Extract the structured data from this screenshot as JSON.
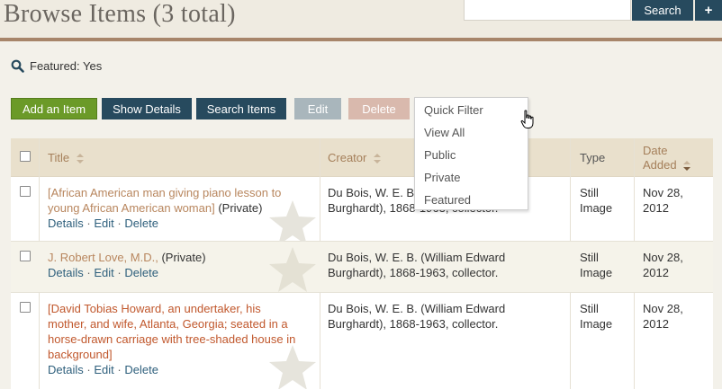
{
  "header": {
    "title": "Browse Items (3 total)",
    "search_placeholder": "",
    "search_button": "Search",
    "advanced_button": "+"
  },
  "filter": {
    "label": "Featured: Yes"
  },
  "toolbar": {
    "add": "Add an Item",
    "show_details": "Show Details",
    "search_items": "Search Items",
    "edit": "Edit",
    "delete": "Delete"
  },
  "dropdown": {
    "options": [
      "Quick Filter",
      "View All",
      "Public",
      "Private",
      "Featured"
    ]
  },
  "table": {
    "headers": {
      "title": "Title",
      "creator": "Creator",
      "type": "Type",
      "date_added_1": "Date",
      "date_added_2": "Added"
    },
    "rows": [
      {
        "title_1": "[African American man giving piano lesson to",
        "title_2": "young African American woman]",
        "status": "(Private)",
        "creator_1": "Du Bois, W. E. B. (",
        "creator_2": "Burghardt), 1868-1963, collector.",
        "type_1": "Still",
        "type_2": "Image",
        "date_1": "Nov 28,",
        "date_2": "2012"
      },
      {
        "title_1": "J. Robert Love, M.D.,",
        "status": "(Private)",
        "creator_1": "Du Bois, W. E. B. (William Edward",
        "creator_2": "Burghardt), 1868-1963, collector.",
        "type_1": "Still",
        "type_2": "Image",
        "date_1": "Nov 28,",
        "date_2": "2012"
      },
      {
        "title_1": "[David Tobias Howard, an undertaker, his",
        "title_2": "mother, and wife, Atlanta, Georgia; seated in a",
        "title_3": "horse-drawn carriage with tree-shaded house in",
        "title_4": "background]",
        "creator_1": "Du Bois, W. E. B. (William Edward",
        "creator_2": "Burghardt), 1868-1963, collector.",
        "type_1": "Still",
        "type_2": "Image",
        "date_1": "Nov 28,",
        "date_2": "2012"
      }
    ],
    "action_details": "Details",
    "action_edit": "Edit",
    "action_delete": "Delete",
    "action_sep": "·"
  },
  "colors": {
    "primary_button": "#274a5e",
    "add_button": "#6b9a28",
    "header_rule": "#a7856a",
    "link": "#2e5f7c"
  }
}
